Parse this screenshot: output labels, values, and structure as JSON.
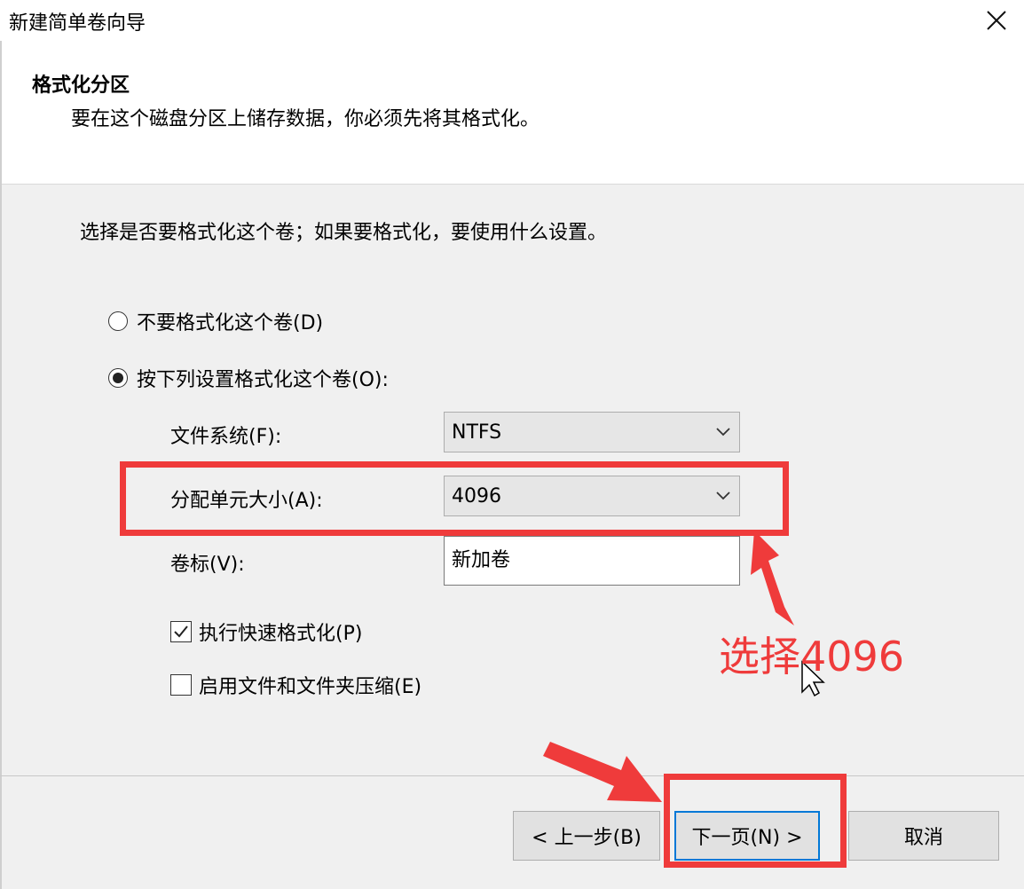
{
  "window": {
    "title": "新建简单卷向导"
  },
  "header": {
    "title": "格式化分区",
    "description": "要在这个磁盘分区上储存数据，你必须先将其格式化。"
  },
  "content": {
    "instruction": "选择是否要格式化这个卷；如果要格式化，要使用什么设置。",
    "options": [
      {
        "label": "不要格式化这个卷(D)",
        "selected": false
      },
      {
        "label": "按下列设置格式化这个卷(O):",
        "selected": true
      }
    ],
    "fields": {
      "filesystem": {
        "label": "文件系统(F):",
        "value": "NTFS"
      },
      "allocation_unit": {
        "label": "分配单元大小(A):",
        "value": "4096"
      },
      "volume_label": {
        "label": "卷标(V):",
        "value": "新加卷"
      }
    },
    "checkboxes": [
      {
        "label": "执行快速格式化(P)",
        "checked": true
      },
      {
        "label": "启用文件和文件夹压缩(E)",
        "checked": false
      }
    ]
  },
  "buttons": {
    "back": "< 上一步(B)",
    "next": "下一页(N) >",
    "cancel": "取消"
  },
  "annotation": {
    "text": "选择4096",
    "color": "#ef3b3b"
  }
}
